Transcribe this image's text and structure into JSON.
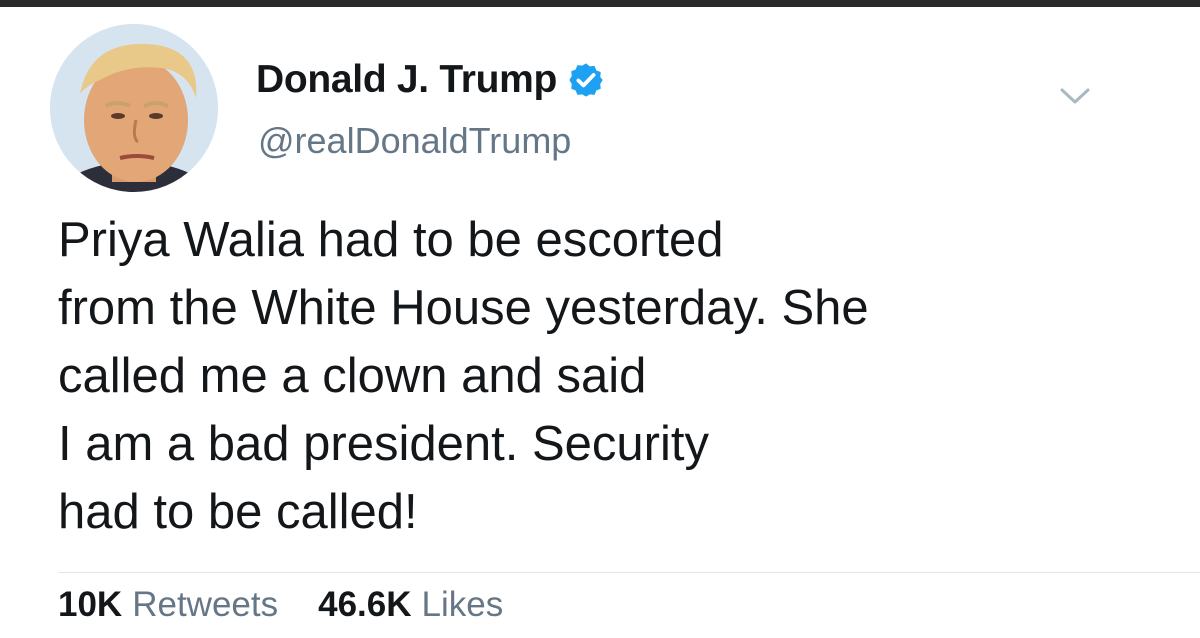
{
  "tweet": {
    "display_name": "Donald J. Trump",
    "handle": "@realDonaldTrump",
    "verified": true,
    "text_lines": [
      "Priya Walia had to be escorted",
      "from the White House yesterday. She",
      "called me a clown and said",
      "I am a bad president. Security",
      "had to be called!"
    ],
    "icons": {
      "avatar": "profile-photo",
      "verified": "verified-badge-icon",
      "menu": "chevron-down-icon"
    }
  },
  "stats": {
    "retweets_value": "10K",
    "retweets_label": "Retweets",
    "likes_value": "46.6K",
    "likes_label": "Likes"
  },
  "colors": {
    "text": "#14171a",
    "secondary": "#657786",
    "verified": "#1da1f2",
    "divider": "#e1e8ed"
  }
}
